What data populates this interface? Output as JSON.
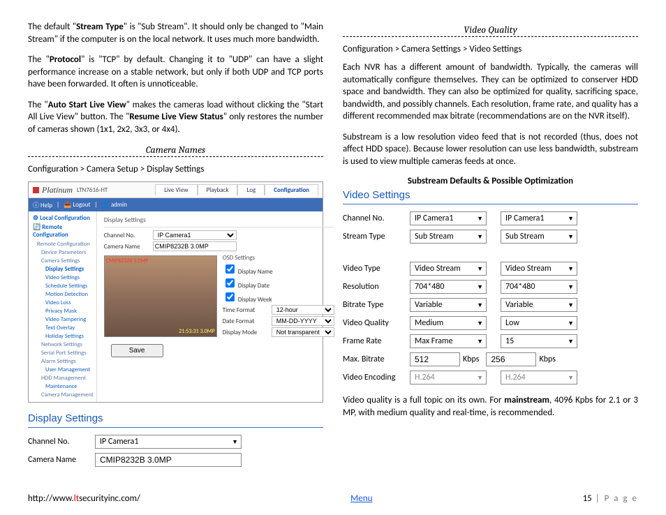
{
  "left": {
    "p1a": "The default \"",
    "p1b": "Stream Type",
    "p1c": "\" is \"Sub Stream\".  It should only be changed to \"Main Stream\" if the computer is on the local network.  It uses much more bandwidth.",
    "p2a": "The \"",
    "p2b": "Protocol",
    "p2c": "\" is \"TCP\" by default.  Changing it to \"UDP\" can have a slight performance increase on a stable network, but only if both UDP and TCP ports have been forwarded.  It often is unnoticeable.",
    "p3a": "The \"",
    "p3b": "Auto Start Live View",
    "p3c": "\" makes the cameras load without clicking the \"Start All Live View\" button.  The \"",
    "p3d": "Resume Live View Status",
    "p3e": "\" only restores the number of cameras shown (1x1, 2x2, 3x3, or 4x4).",
    "sec_title": "Camera Names",
    "breadcrumb": "Configuration > Camera Setup > Display Settings"
  },
  "nvr": {
    "brand": "Platinum",
    "model": "LTN7616-HT",
    "tabs": {
      "live": "Live View",
      "playback": "Playback",
      "log": "Log",
      "config": "Configuration"
    },
    "blue": {
      "help": "Help",
      "logout": "Logout",
      "user": "admin"
    },
    "side": {
      "local": "Local Configuration",
      "remote": "Remote Configuration",
      "items": [
        "Remote Configuration",
        "Device Parameters",
        "Camera Settings",
        "Display Settings",
        "Video Settings",
        "Schedule Settings",
        "Motion Detection",
        "Video Loss",
        "Privacy Mask",
        "Video Tampering",
        "Text Overlay",
        "Holiday Settings",
        "Network Settings",
        "Serial Port Settings",
        "Alarm Settings",
        "User Management",
        "HDD Management",
        "Maintenance",
        "Camera Management"
      ]
    },
    "panel": {
      "head": "Display Settings",
      "channel_lab": "Channel No.",
      "channel_val": "IP Camera1",
      "name_lab": "Camera Name",
      "name_val": "CMIP8232B 3.0MP",
      "osd_head": "OSD Settings",
      "disp_name": "Display Name",
      "disp_date": "Display Date",
      "disp_week": "Display Week",
      "time_lab": "Time Format",
      "time_val": "12-hour",
      "date_lab": "Date Format",
      "date_val": "MM-DD-YYYY",
      "mode_lab": "Display Mode",
      "mode_val": "Not transparent & Not flashing",
      "save": "Save"
    }
  },
  "display_big": {
    "head": "Display Settings",
    "ch_lab": "Channel No.",
    "ch_val": "IP Camera1",
    "nm_lab": "Camera Name",
    "nm_val": "CMIP8232B 3.0MP"
  },
  "right": {
    "sec_title": "Video Quality",
    "breadcrumb": "Configuration > Camera Settings > Video Settings",
    "p1": "Each NVR has a different amount of bandwidth.  Typically, the cameras will automatically configure themselves.  They can be optimized to conserver HDD space and bandwidth.  They can also be optimized for quality, sacrificing space, bandwidth, and possibly channels. Each resolution, frame rate, and quality has a different recommended max bitrate (recommendations are on the NVR itself).",
    "p2": "Substream is a low resolution video feed that is not recorded (thus, does not affect HDD space).  Because lower resolution can use less bandwidth, substream is used to view multiple cameras feeds at once.",
    "subhead": "Substream Defaults & Possible Optimization",
    "p3a": "Video quality is a full topic on its own.  For ",
    "p3b": "mainstream",
    "p3c": ", 4096 Kpbs for 2.1 or 3 MP, with medium quality and real-time, is recommended."
  },
  "video": {
    "head": "Video Settings",
    "labels": {
      "channel": "Channel No.",
      "stream": "Stream Type",
      "vtype": "Video Type",
      "res": "Resolution",
      "btype": "Bitrate Type",
      "qual": "Video Quality",
      "frate": "Frame Rate",
      "maxb": "Max. Bitrate",
      "enc": "Video Encoding"
    },
    "colA": {
      "channel": "IP Camera1",
      "stream": "Sub Stream",
      "vtype": "Video Stream",
      "res": "704*480",
      "btype": "Variable",
      "qual": "Medium",
      "frate": "Max Frame",
      "maxb": "512",
      "enc": "H.264"
    },
    "colB": {
      "channel": "IP Camera1",
      "stream": "Sub Stream",
      "vtype": "Video Stream",
      "res": "704*480",
      "btype": "Variable",
      "qual": "Low",
      "frate": "15",
      "maxb": "256",
      "enc": "H.264"
    },
    "kbps": "Kbps"
  },
  "footer": {
    "url_pre": "http://www.",
    "url_lt": "lt",
    "url_post": "securityinc.com/",
    "menu": "Menu",
    "pagenum": "15",
    "pagelabel": " | P a g e"
  }
}
